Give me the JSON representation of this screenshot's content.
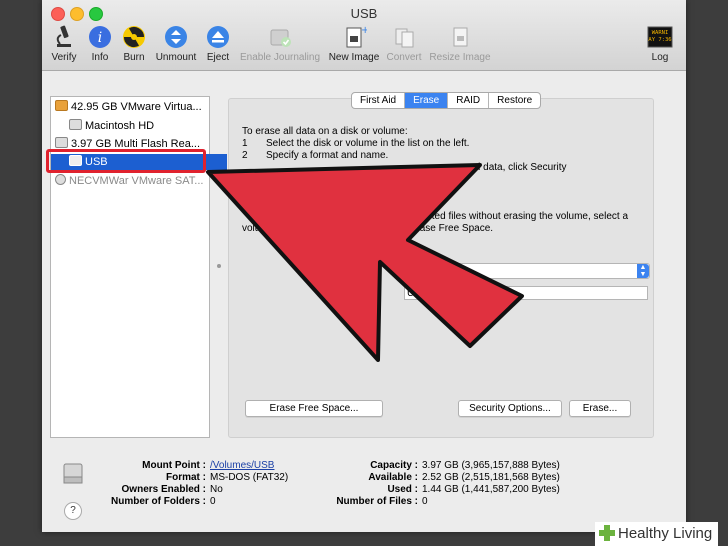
{
  "window": {
    "title": "USB"
  },
  "toolbar": [
    {
      "label": "Verify",
      "icon": "microscope-icon",
      "enabled": true
    },
    {
      "label": "Info",
      "icon": "info-icon",
      "enabled": true
    },
    {
      "label": "Burn",
      "icon": "burn-icon",
      "enabled": true
    },
    {
      "label": "Unmount",
      "icon": "unmount-icon",
      "enabled": true
    },
    {
      "label": "Eject",
      "icon": "eject-icon",
      "enabled": true
    },
    {
      "label": "Enable Journaling",
      "icon": "journaling-icon",
      "enabled": false
    },
    {
      "label": "New Image",
      "icon": "new-image-icon",
      "enabled": true
    },
    {
      "label": "Convert",
      "icon": "convert-icon",
      "enabled": false
    },
    {
      "label": "Resize Image",
      "icon": "resize-image-icon",
      "enabled": false
    },
    {
      "label": "Log",
      "icon": "log-icon",
      "enabled": true,
      "badge": "WARNI\nAY 7:36"
    }
  ],
  "sidebar": {
    "items": [
      {
        "label": "42.95 GB VMware Virtua...",
        "level": 0
      },
      {
        "label": "Macintosh HD",
        "level": 1
      },
      {
        "label": "3.97 GB Multi Flash Rea...",
        "level": 0
      },
      {
        "label": "USB",
        "level": 1,
        "selected": true
      },
      {
        "label": "NECVMWar VMware SAT...",
        "level": 0,
        "dim": true
      }
    ]
  },
  "tabs": [
    {
      "label": "First Aid",
      "active": false
    },
    {
      "label": "Erase",
      "active": true
    },
    {
      "label": "RAID",
      "active": false
    },
    {
      "label": "Restore",
      "active": false
    }
  ],
  "erase": {
    "intro": "To erase all data on a disk or volume:",
    "steps": [
      {
        "num": "1",
        "text": "Select the disk or volume in the list on the left."
      },
      {
        "num": "2",
        "text": "Specify a format and name."
      },
      {
        "num": "",
        "text": "s erased data, click Security"
      }
    ],
    "para2_line1": "leted files without erasing the volume, select a",
    "para2_line2_left": "volu",
    "para2_line2_right": "rase Free Space.",
    "name_value": "USB",
    "buttons": {
      "erase_free_space": "Erase Free Space...",
      "security_options": "Security Options...",
      "erase": "Erase..."
    }
  },
  "info": {
    "left": [
      {
        "key": "Mount Point :",
        "value": "/Volumes/USB",
        "link": true
      },
      {
        "key": "Format :",
        "value": "MS-DOS (FAT32)"
      },
      {
        "key": "Owners Enabled :",
        "value": "No"
      },
      {
        "key": "Number of Folders :",
        "value": "0"
      }
    ],
    "right": [
      {
        "key": "Capacity :",
        "value": "3.97 GB (3,965,157,888 Bytes)"
      },
      {
        "key": "Available :",
        "value": "2.52 GB (2,515,181,568 Bytes)"
      },
      {
        "key": "Used :",
        "value": "1.44 GB (1,441,587,200 Bytes)"
      },
      {
        "key": "Number of Files :",
        "value": "0"
      }
    ]
  },
  "help": {
    "label": "?"
  },
  "watermark": {
    "text": "Healthy Living"
  },
  "colors": {
    "selection": "#1c5fd1",
    "arrow": "#e0313f",
    "tab_active": "#3b83f0"
  }
}
